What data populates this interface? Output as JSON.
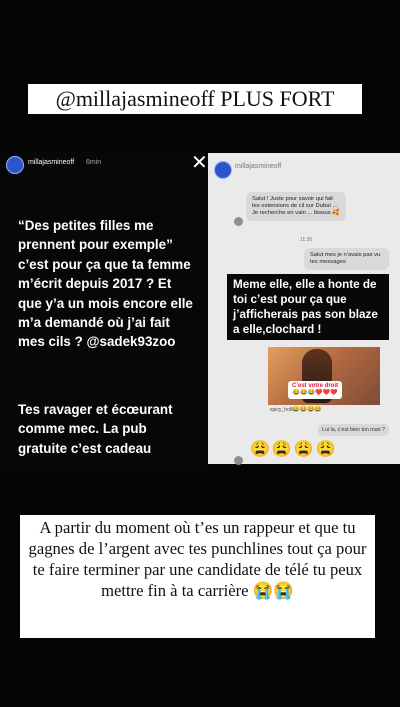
{
  "header": {
    "title": "@millajasmineoff  PLUS FORT"
  },
  "left_story": {
    "username": "millajasmineoff",
    "time": "6min",
    "close_icon": "✕",
    "main_text": "“Des petites filles me prennent pour exemple” c’est pour ça que ta femme m’écrit depuis 2017 ? Et que y’a un mois encore elle m’a demandé où j’ai fait mes cils ? @sadek93zoo",
    "secondary_text": "Tes ravager et écœurant comme mec. La pub gratuite c’est cadeau"
  },
  "right_story": {
    "username": "millajasmineoff",
    "message_1": "Salut ! Juste pour savoir qui fait tes extensions de cil sur Dubaï ... Je recherche en vain ... bisous 🥰",
    "timestamp": "11:30",
    "message_2": "Salut mes je n’avais pas vu tes messages",
    "overlay_text": "Meme elle, elle a honte de toi c’est pour ça que j’afficherais pas son blaze a elle,clochard !",
    "photo_label": "C’est votre droit",
    "photo_reactions": "😂😂😂❤️❤️❤️",
    "reaction_user": "spicy_hollow",
    "reaction_emojis": "😂😂😂😂",
    "reply_text": "Lui la, c’est bien ton mari ?",
    "bottom_emojis": "😩😩😩😩"
  },
  "bottom_caption": {
    "text": "A partir du moment où t’es un rappeur et que tu gagnes de l’argent avec tes punchlines tout ça pour te faire terminer par une candidate de télé tu peux mettre fin à ta carrière 😭😭"
  }
}
